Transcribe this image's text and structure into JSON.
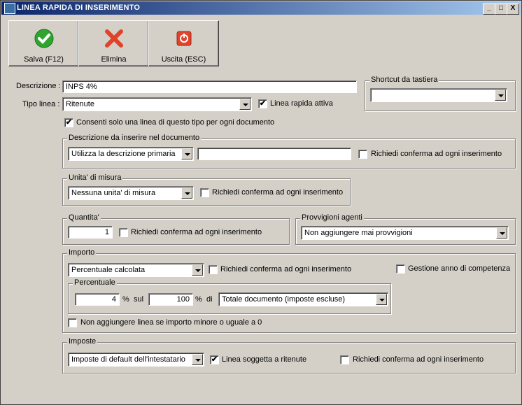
{
  "window": {
    "title": "LINEA RAPIDA DI INSERIMENTO",
    "min": "_",
    "max": "□",
    "close": "X"
  },
  "toolbar": {
    "save": "Salva (F12)",
    "delete": "Elimina",
    "exit": "Uscita (ESC)"
  },
  "descrizione": {
    "label": "Descrizione :",
    "value": "INPS 4%"
  },
  "tipo_linea": {
    "label": "Tipo linea :",
    "value": "Ritenute"
  },
  "linea_rapida_attiva": {
    "label": "Linea rapida attiva",
    "checked": "✔"
  },
  "consenti": {
    "label": "Consenti solo una linea di questo tipo per ogni documento",
    "checked": "✔"
  },
  "shortcut": {
    "legend": "Shortcut da tastiera",
    "value": ""
  },
  "descrizione_doc": {
    "legend": "Descrizione da inserire nel documento",
    "select": "Utilizza la descrizione primaria",
    "text": "",
    "confirm": "Richiedi conferma ad ogni inserimento"
  },
  "unita": {
    "legend": "Unita' di misura",
    "select": "Nessuna unita' di misura",
    "confirm": "Richiedi conferma ad ogni inserimento"
  },
  "quantita": {
    "legend": "Quantita'",
    "value": "1",
    "confirm": "Richiedi conferma ad ogni inserimento"
  },
  "provvigioni": {
    "legend": "Provvigioni agenti",
    "select": "Non aggiungere mai provvigioni"
  },
  "importo": {
    "legend": "Importo",
    "select": "Percentuale calcolata",
    "confirm": "Richiedi conferma ad ogni inserimento",
    "gestione": "Gestione anno di competenza",
    "no_add": "Non aggiungere linea se importo minore o uguale a 0"
  },
  "percentuale": {
    "legend": "Percentuale",
    "value": "4",
    "pct1": "%",
    "sul": "sul",
    "base": "100",
    "pct2": "%",
    "di": "di",
    "select": "Totale documento (imposte escluse)"
  },
  "imposte": {
    "legend": "Imposte",
    "select": "Imposte di default dell'intestatario",
    "soggetta": "Linea soggetta a ritenute",
    "soggetta_checked": "✔",
    "confirm": "Richiedi conferma ad ogni inserimento"
  }
}
